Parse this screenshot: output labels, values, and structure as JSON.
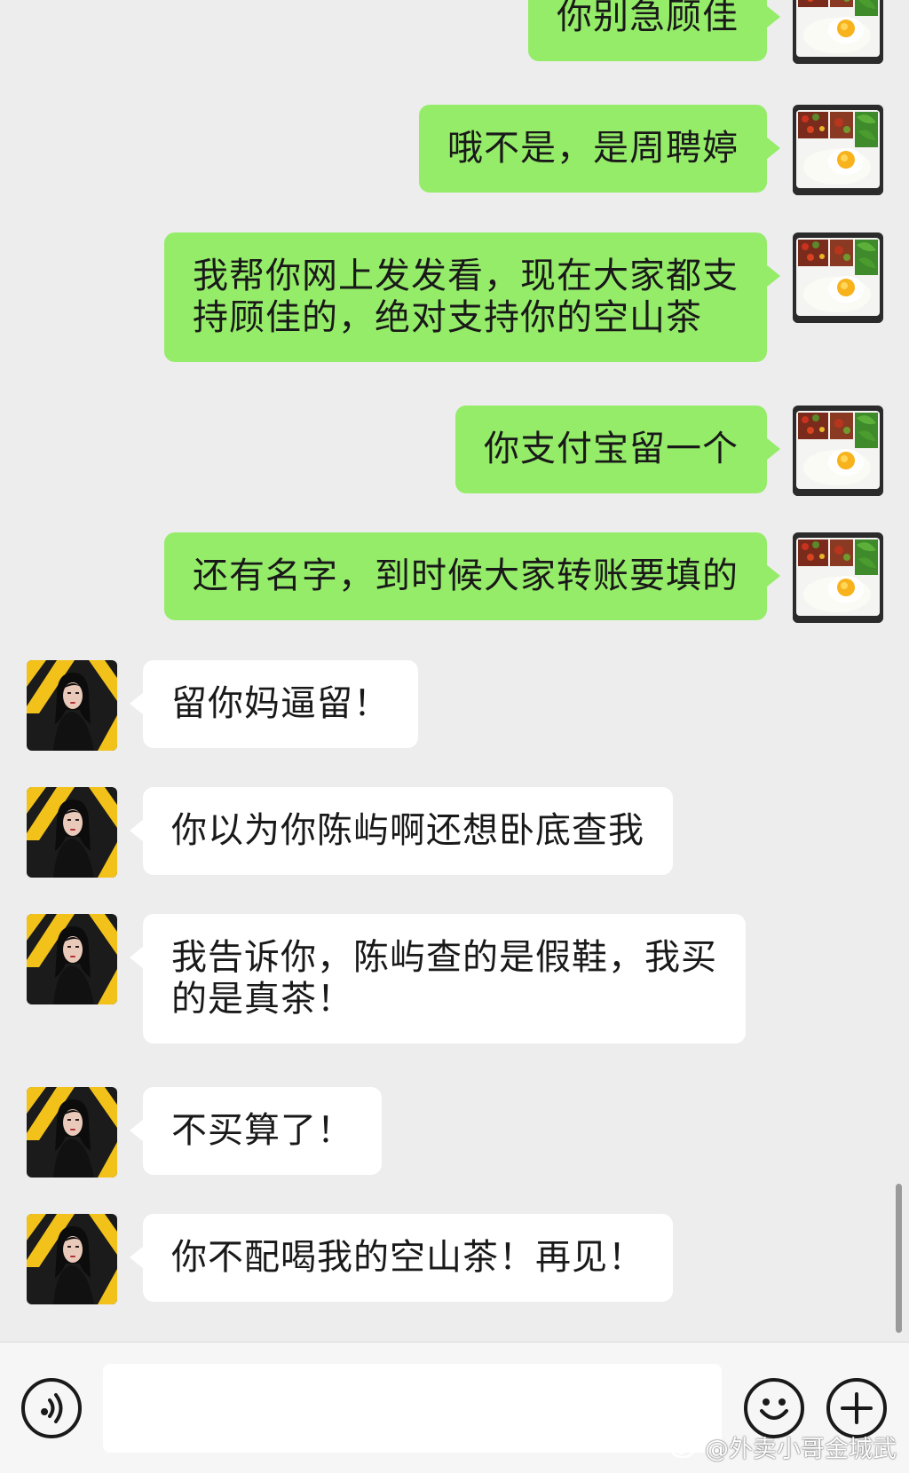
{
  "messages": [
    {
      "side": "mine",
      "avatar": "lunchbox-avatar",
      "text": "你别急顾佳"
    },
    {
      "side": "mine",
      "avatar": "lunchbox-avatar",
      "text": "哦不是，是周聘婷"
    },
    {
      "side": "mine",
      "avatar": "lunchbox-avatar",
      "text": "我帮你网上发发看，现在大家都支\n持顾佳的，绝对支持你的空山茶"
    },
    {
      "side": "mine",
      "avatar": "lunchbox-avatar",
      "text": "你支付宝留一个"
    },
    {
      "side": "mine",
      "avatar": "lunchbox-avatar",
      "text": "还有名字，到时候大家转账要填的"
    },
    {
      "side": "theirs",
      "avatar": "woman-avatar",
      "text": "留你妈逼留！"
    },
    {
      "side": "theirs",
      "avatar": "woman-avatar",
      "text": "你以为你陈屿啊还想卧底查我"
    },
    {
      "side": "theirs",
      "avatar": "woman-avatar",
      "text": "我告诉你，陈屿查的是假鞋，我买\n的是真茶！"
    },
    {
      "side": "theirs",
      "avatar": "woman-avatar",
      "text": "不买算了！"
    },
    {
      "side": "theirs",
      "avatar": "woman-avatar",
      "text": "你不配喝我的空山茶！再见！"
    }
  ],
  "input_bar": {
    "input_value": "",
    "voice_icon": "voice-icon",
    "emoji_icon": "emoji-icon",
    "plus_icon": "plus-icon"
  },
  "watermark": {
    "text": "@外卖小哥金城武",
    "logo": "weibo-logo"
  },
  "colors": {
    "background": "#ededed",
    "my_bubble": "#95ec69",
    "their_bubble": "#ffffff",
    "text": "#191919"
  }
}
